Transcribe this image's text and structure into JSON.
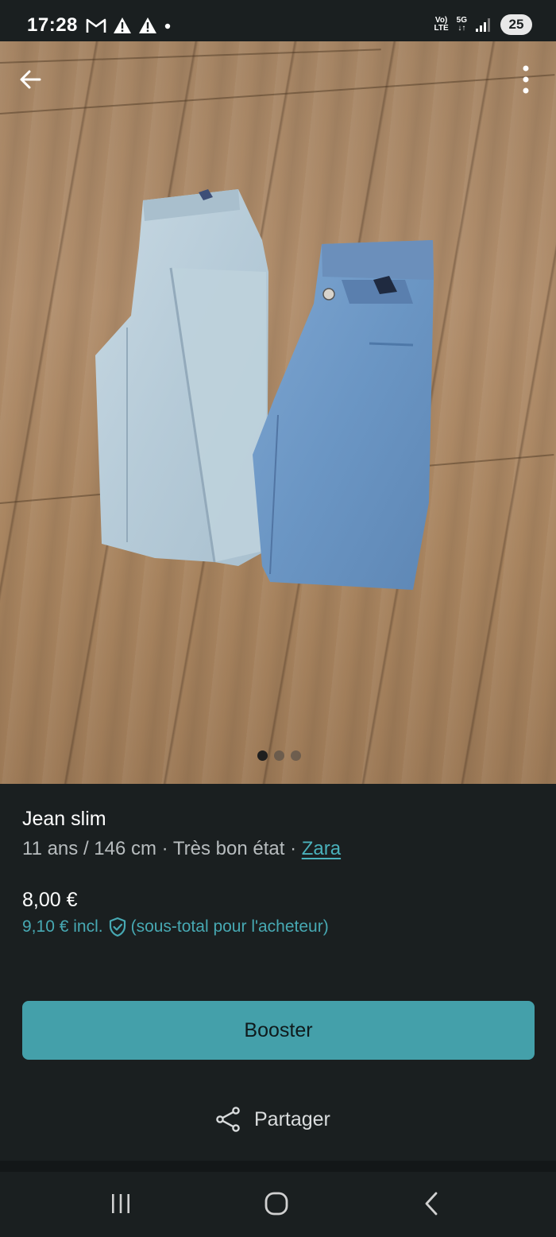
{
  "status_bar": {
    "time": "17:28",
    "network_top": "Vo)",
    "network_bottom": "LTE",
    "signal_type": "5G",
    "battery": "25",
    "icons": [
      "gmail-icon",
      "alert-icon",
      "alert-icon",
      "dot-icon",
      "signal-icon"
    ]
  },
  "photo": {
    "description_icons": [
      "back-arrow-icon",
      "more-vertical-icon"
    ],
    "pager": {
      "count": 3,
      "active_index": 0
    }
  },
  "listing": {
    "title": "Jean slim",
    "details": "11 ans / 146 cm · Très bon état · ",
    "brand": "Zara",
    "price": "8,00 €",
    "price_incl": "9,10 €  incl.",
    "price_incl_note": "(sous-total pour l'acheteur)"
  },
  "actions": {
    "booster_label": "Booster",
    "share_label": "Partager"
  },
  "colors": {
    "background": "#1a1f20",
    "accent": "#44a0aa",
    "link": "#4ab1bb"
  }
}
